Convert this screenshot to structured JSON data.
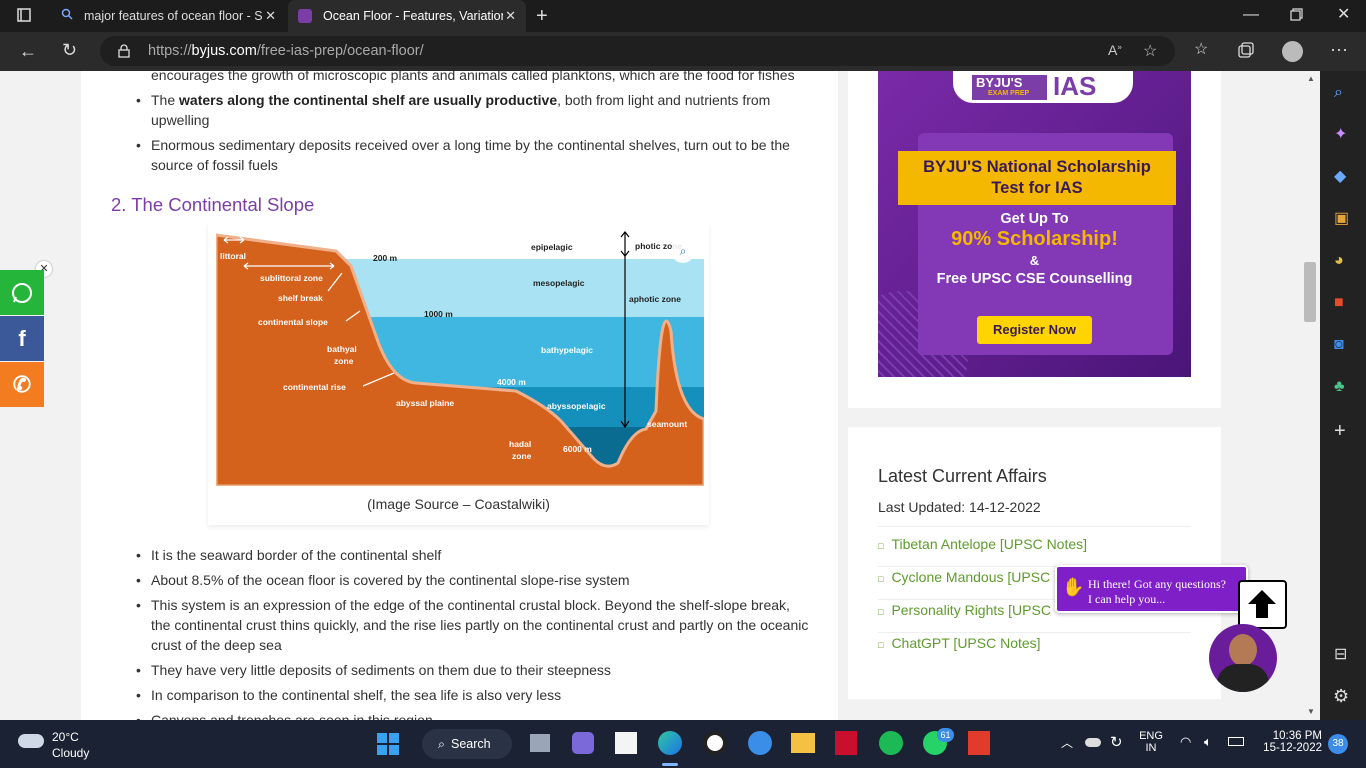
{
  "browser": {
    "tabs": [
      {
        "title": "major features of ocean floor - S"
      },
      {
        "title": "Ocean Floor - Features, Variation"
      }
    ],
    "url_prefix": "https://",
    "url_domain": "byjus.com",
    "url_path": "/free-ias-prep/ocean-floor/"
  },
  "article": {
    "top_cut_text": "encourages the growth of microscopic plants and animals called planktons, which are the food for fishes",
    "shelf_bullets": [
      {
        "bold": "waters along the continental shelf are usually productive",
        "pre": "The ",
        "post": ", both from light and nutrients from upwelling"
      },
      {
        "text": "Enormous sedimentary deposits received over a long time by the continental shelves, turn out to be the source of fossil fuels"
      }
    ],
    "section_heading": "2. The Continental Slope",
    "figure_caption": "(Image Source – Coastalwiki)",
    "slope_bullets": [
      "It is the seaward border of the continental shelf",
      "About 8.5% of the ocean floor is covered by the continental slope-rise system",
      "This system is an expression of the edge of the continental crustal block. Beyond the shelf-slope break, the continental crust thins quickly, and the rise lies partly on the continental crust and partly on the oceanic crust of the deep sea",
      "They have very little deposits of sediments on them due to their steepness",
      "In comparison to the continental shelf, the sea life is also very less",
      "Canyons and trenches are seen in this region"
    ]
  },
  "diagram": {
    "labels": {
      "littoral": "littoral",
      "sublittoral": "sublittoral zone",
      "shelf_break": "shelf break",
      "continental_slope": "continental slope",
      "bathyal": "bathyal",
      "bathyal2": "zone",
      "continental_rise": "continental rise",
      "abyssal_plaine": "abyssal plaine",
      "hadal": "hadal",
      "hadal2": "zone",
      "d200": "200 m",
      "d1000": "1000 m",
      "d4000": "4000 m",
      "d6000": "6000 m",
      "epipelagic": "epipelagic",
      "mesopelagic": "mesopelagic",
      "bathypelagic": "bathypelagic",
      "abyssopelagic": "abyssopelagic",
      "photic": "photic zone",
      "aphotic": "aphotic zone",
      "seamount": "seamount"
    }
  },
  "ad": {
    "logo": "BYJU'S",
    "logo_sub": "EXAM PREP",
    "logo_ias": "IAS",
    "title1": "BYJU'S National Scholarship",
    "title2": "Test for IAS",
    "line1": "Get Up To",
    "highlight": "90% Scholarship!",
    "amp": "&",
    "line3": "Free UPSC CSE Counselling",
    "cta": "Register Now"
  },
  "current_affairs": {
    "heading": "Latest Current Affairs",
    "updated": "Last Updated: 14-12-2022",
    "items": [
      "Tibetan Antelope [UPSC Notes]",
      "Cyclone Mandous [UPSC",
      "Personality Rights [UPSC",
      "ChatGPT [UPSC Notes]"
    ]
  },
  "chat": {
    "line1": "Hi there! Got any questions?",
    "line2": "I can help you..."
  },
  "taskbar": {
    "temp": "20°C",
    "weather": "Cloudy",
    "search": "Search",
    "lang1": "ENG",
    "lang2": "IN",
    "time": "10:36 PM",
    "date": "15-12-2022",
    "notif": "38",
    "whatsapp_badge": "61"
  },
  "colors": {
    "accent_purple": "#7b3ea8",
    "link_green": "#5f9b2c",
    "land": "#d4611c",
    "ad_bg": "#5f1f8f",
    "ad_banner": "#f5b800"
  }
}
